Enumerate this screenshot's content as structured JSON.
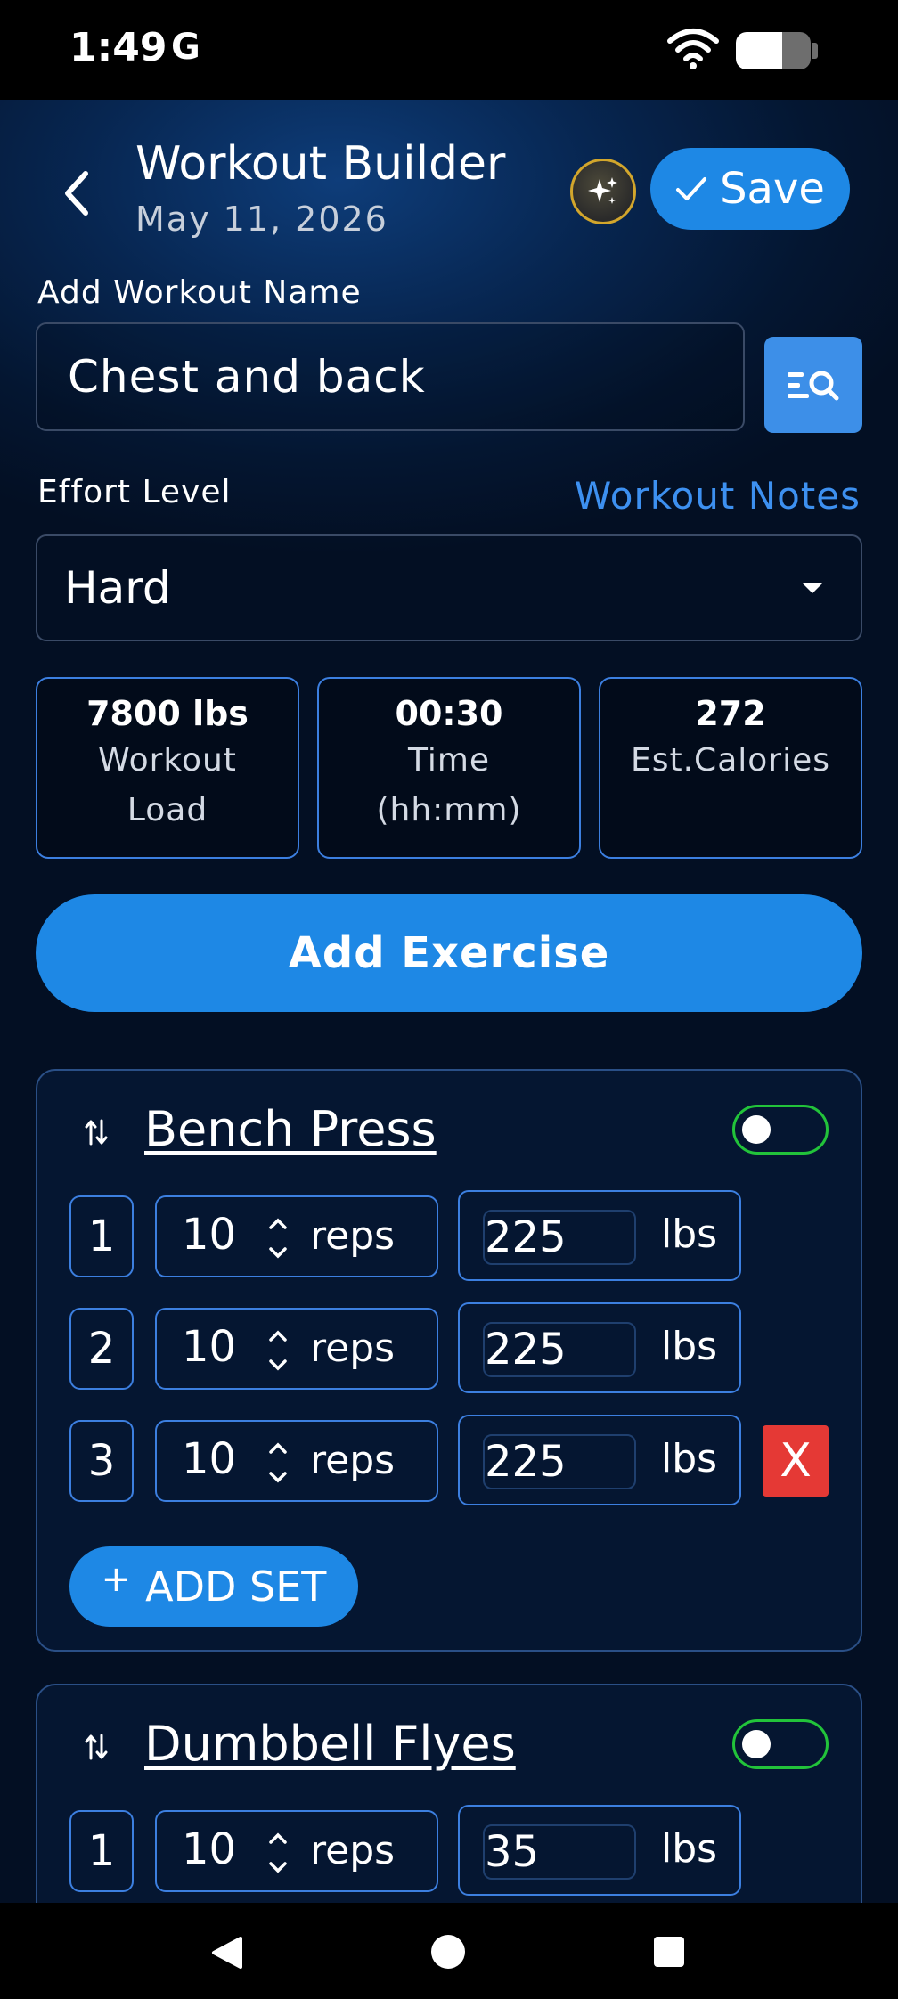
{
  "status_bar": {
    "time": "1:49",
    "carrier": "G",
    "battery_level": 0.62
  },
  "header": {
    "title": "Workout Builder",
    "date": "May 11, 2026",
    "save_label": "Save"
  },
  "form": {
    "name_label": "Add Workout Name",
    "name_value": "Chest and back",
    "effort_label": "Effort Level",
    "notes_link": "Workout Notes",
    "effort_value": "Hard"
  },
  "stats": [
    {
      "value": "7800 lbs",
      "label_line1": "Workout",
      "label_line2": "Load"
    },
    {
      "value": "00:30",
      "label_line1": "Time",
      "label_line2": "(hh:mm)"
    },
    {
      "value": "272",
      "label_line1": "Est.Calories",
      "label_line2": ""
    }
  ],
  "add_exercise_label": "Add Exercise",
  "exercises": [
    {
      "name": "Bench Press",
      "toggle_on": false,
      "sets": [
        {
          "num": "1",
          "reps": "10",
          "reps_unit": "reps",
          "weight": "225",
          "weight_unit": "lbs"
        },
        {
          "num": "2",
          "reps": "10",
          "reps_unit": "reps",
          "weight": "225",
          "weight_unit": "lbs"
        },
        {
          "num": "3",
          "reps": "10",
          "reps_unit": "reps",
          "weight": "225",
          "weight_unit": "lbs",
          "delete": "X"
        }
      ],
      "add_set_label": "ADD SET",
      "add_set_plus": "+"
    },
    {
      "name": "Dumbbell Flyes",
      "toggle_on": false,
      "sets": [
        {
          "num": "1",
          "reps": "10",
          "reps_unit": "reps",
          "weight": "35",
          "weight_unit": "lbs"
        }
      ]
    }
  ],
  "colors": {
    "accent": "#1e88e5",
    "card_border": "#3c7fe0",
    "delete": "#e53935",
    "toggle_border": "#22c33a",
    "link": "#3d90f0"
  },
  "icons": {
    "back": "chevron-left-icon",
    "ai": "sparkle-icon",
    "save": "check-icon",
    "search_list": "list-search-icon",
    "dropdown": "caret-down-icon",
    "drag": "reorder-arrows-icon",
    "stepper": "chevron-up-down-icon"
  }
}
